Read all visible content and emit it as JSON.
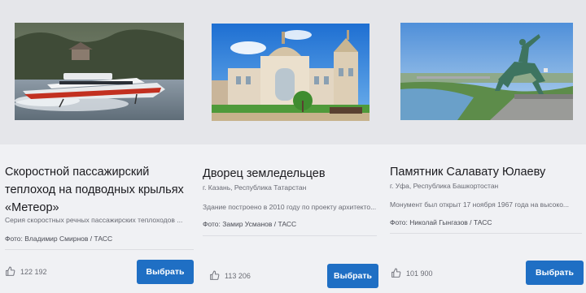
{
  "cards": [
    {
      "title": "Скоростной пассажирский теплоход на подводных крыльях «Метеор»",
      "location": "",
      "description": "Серия скоростных речных пассажирских теплоходов ...",
      "credit": "Фото: Владимир Смирнов / ТАСС",
      "likes": "122 192",
      "button_label": "Выбрать",
      "photo_subject": "hydrofoil-meteor"
    },
    {
      "title": "Дворец земледельцев",
      "location": "г. Казань, Республика Татарстан",
      "description": "Здание построено в 2010 году по проекту архитекто...",
      "credit": "Фото: Замир Усманов / ТАСС",
      "likes": "113 206",
      "button_label": "Выбрать",
      "photo_subject": "palace-of-farmers"
    },
    {
      "title": "Памятник Салавату Юлаеву",
      "location": "г. Уфа, Республика Башкортостан",
      "description": "Монумент был открыт 17 ноября 1967 года на высоко...",
      "credit": "Фото: Николай Гынгазов / ТАСС",
      "likes": "101 900",
      "button_label": "Выбрать",
      "photo_subject": "salavat-yulaev-monument"
    }
  ],
  "colors": {
    "button": "#1f6fc4",
    "page_background": "#f0f1f4"
  },
  "icons": {
    "like": "thumbs-up-icon"
  }
}
